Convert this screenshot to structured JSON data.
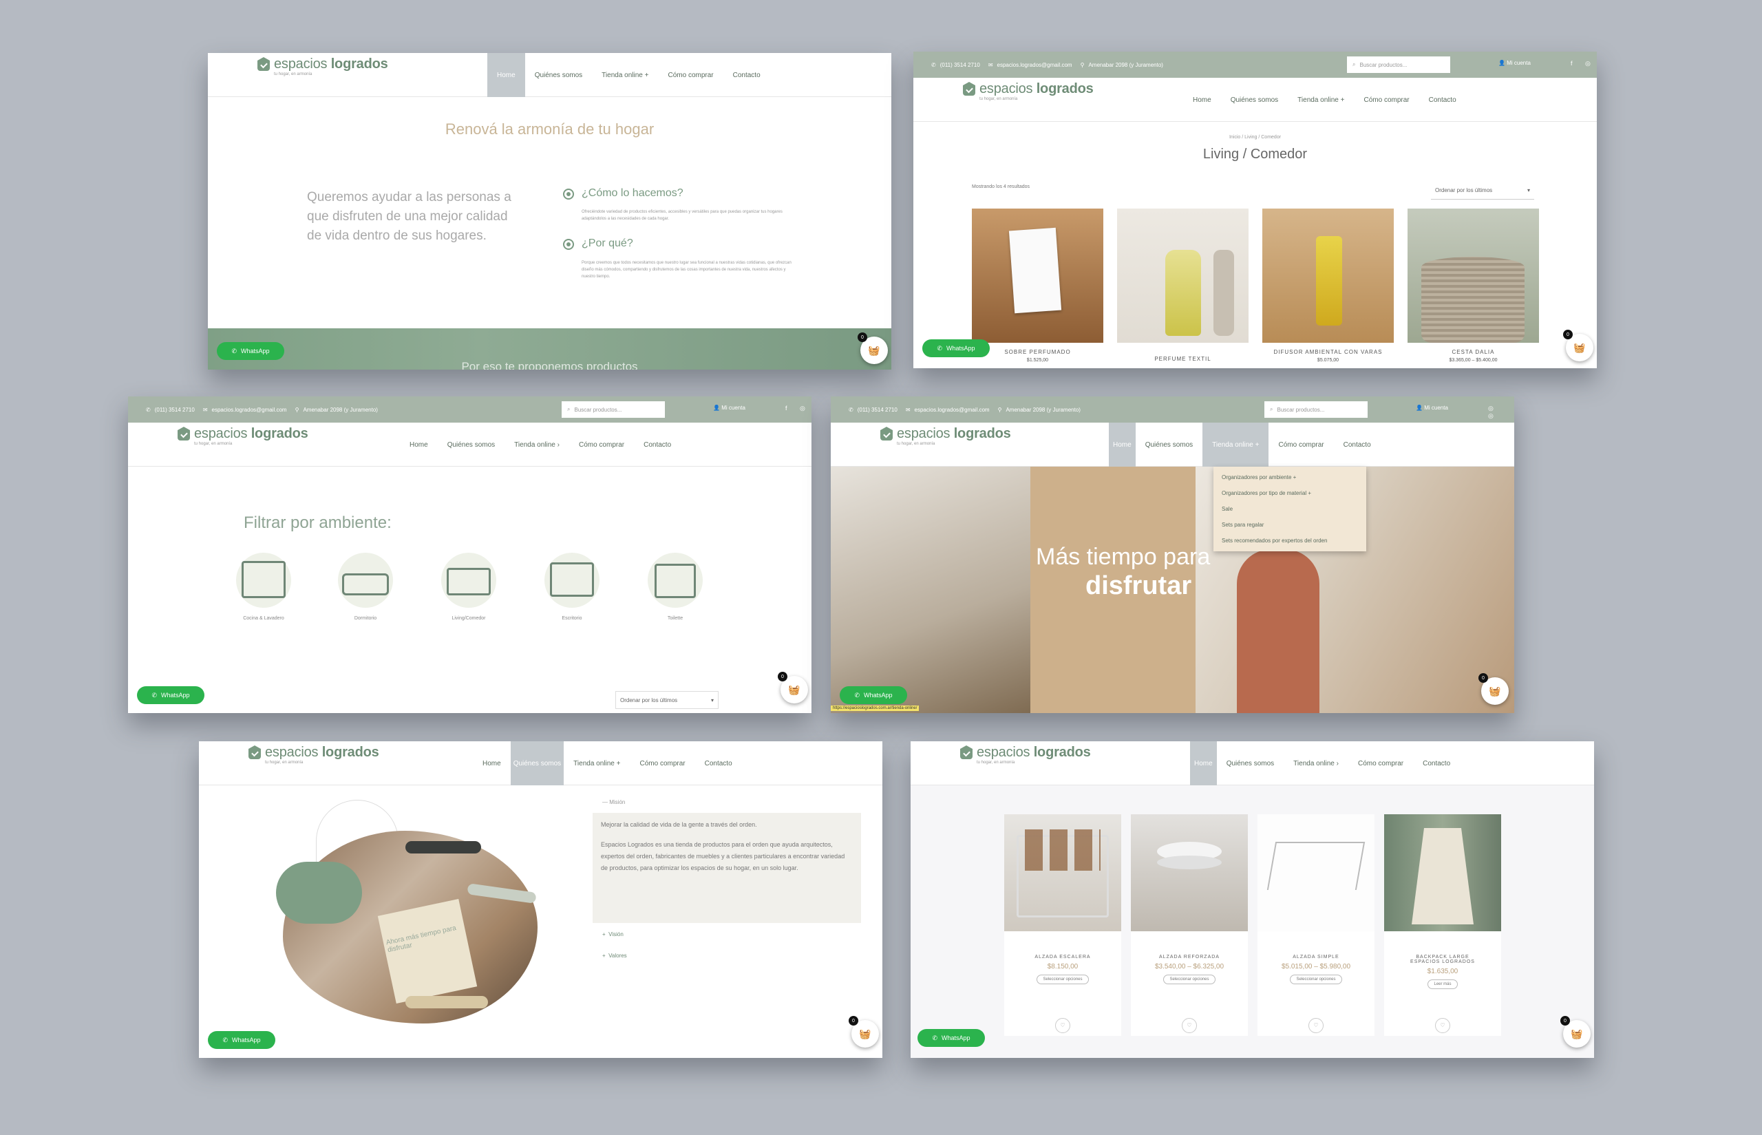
{
  "brand": {
    "name_light": "espacios",
    "name_bold": "logrados",
    "tagline": "tu hogar, en armonía"
  },
  "colors": {
    "accent": "#7a9a82",
    "topbar": "#a7b5a8",
    "whatsapp": "#2bb34d",
    "background": "#b5bac2"
  },
  "nav": {
    "home": "Home",
    "about": "Quiénes somos",
    "shop": "Tienda online",
    "howto": "Cómo comprar",
    "contact": "Contacto"
  },
  "topbar": {
    "phone": "(011) 3514 2710",
    "email": "espacios.logrados@gmail.com",
    "address": "Amenabar 2098 (y Juramento)",
    "search_placeholder": "Buscar productos...",
    "account": "Mi cuenta"
  },
  "whatsapp_label": "WhatsApp",
  "cart_count": "0",
  "s1": {
    "title": "Renová la armonía de tu hogar",
    "lead": "Queremos ayudar a las personas a que disfruten de una mejor calidad de vida dentro de sus hogares.",
    "q1": "¿Cómo lo hacemos?",
    "a1": "Ofreciéndote variedad de productos eficientes, accesibles y versátiles para que puedas organizar tus hogares adaptándolos a las necesidades de cada hogar.",
    "q2": "¿Por qué?",
    "a2": "Porque creemos que todos necesitamos que nuestro lugar sea funcional a nuestras vidas cotidianas, que ofrezcan diseño más cómodos, compartiendo y disfrutemos de las cosas importantes de nuestra vida, nuestros afectos y nuestro tiempo.",
    "bottom": "Por eso te proponemos productos"
  },
  "s2": {
    "breadcrumb": "Inicio / Living / Comedor",
    "title": "Living / Comedor",
    "results": "Mostrando los 4 resultados",
    "sort": "Ordenar por los últimos",
    "products": [
      {
        "name": "SOBRE PERFUMADO",
        "price": "$1.525,00"
      },
      {
        "name": "PERFUME TEXTIL",
        "price": ""
      },
      {
        "name": "DIFUSOR AMBIENTAL CON VARAS",
        "price": "$5.075,00"
      },
      {
        "name": "CESTA DALIA",
        "price": "$3.365,00 – $5.400,00"
      }
    ]
  },
  "s3": {
    "title": "Filtrar por ambiente:",
    "rooms": [
      "Cocina & Lavadero",
      "Dormitorio",
      "Living/Comedor",
      "Escritorio",
      "Toilette"
    ],
    "sort": "Ordenar por los últimos"
  },
  "s4": {
    "hero_line1": "Más tiempo para",
    "hero_line2": "disfrutar",
    "menu": [
      "Organizadores por ambiente",
      "Organizadores por tipo de material",
      "Sale",
      "Sets para regalar",
      "Sets recomendados por expertos del orden"
    ],
    "status_url": "https://espacioslogrados.com.ar/tienda-online/"
  },
  "s5": {
    "mission_label": "Misión",
    "mission_short": "Mejorar la calidad de vida de la gente a través del orden.",
    "mission_long": "Espacios Logrados es una tienda de productos para el orden que ayuda arquitectos, expertos del orden, fabricantes de muebles y a clientes particulares a encontrar variedad de productos, para optimizar los espacios de su hogar, en un solo lugar.",
    "vision": "Visión",
    "values": "Valores",
    "bag_text": "Ahora más tiempo para disfrutar"
  },
  "s6": {
    "products": [
      {
        "name": "ALZADA ESCALERA",
        "price": "$8.150,00",
        "btn": "Seleccionar opciones"
      },
      {
        "name": "ALZADA REFORZADA",
        "price": "$3.540,00 – $6.325,00",
        "btn": "Seleccionar opciones"
      },
      {
        "name": "ALZADA SIMPLE",
        "price": "$5.015,00 – $5.980,00",
        "btn": "Seleccionar opciones"
      },
      {
        "name": "BACKPACK LARGE ESPACIOS LOGRADOS",
        "price": "$1.635,00",
        "btn": "Leer más"
      }
    ]
  }
}
